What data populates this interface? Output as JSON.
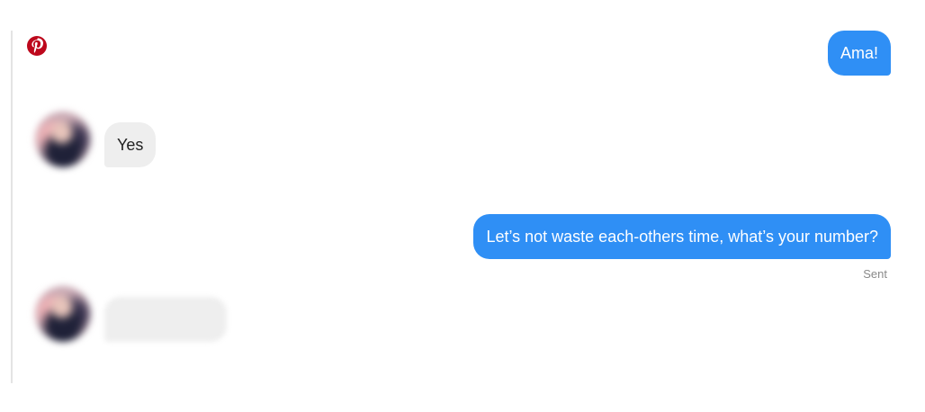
{
  "conversation": {
    "messages": [
      {
        "sender": "me",
        "text": "Ama!"
      },
      {
        "sender": "them",
        "text": "Yes"
      },
      {
        "sender": "me",
        "text": "Let’s not waste each-others time, what’s your number?",
        "status": "Sent"
      },
      {
        "sender": "them",
        "text": "",
        "blurred": true
      }
    ]
  },
  "colors": {
    "outgoing_bubble": "#2f8ff5",
    "incoming_bubble": "#eeeeee",
    "pinterest_brand": "#bd081c"
  },
  "icons": {
    "top_left": "pinterest-icon"
  }
}
